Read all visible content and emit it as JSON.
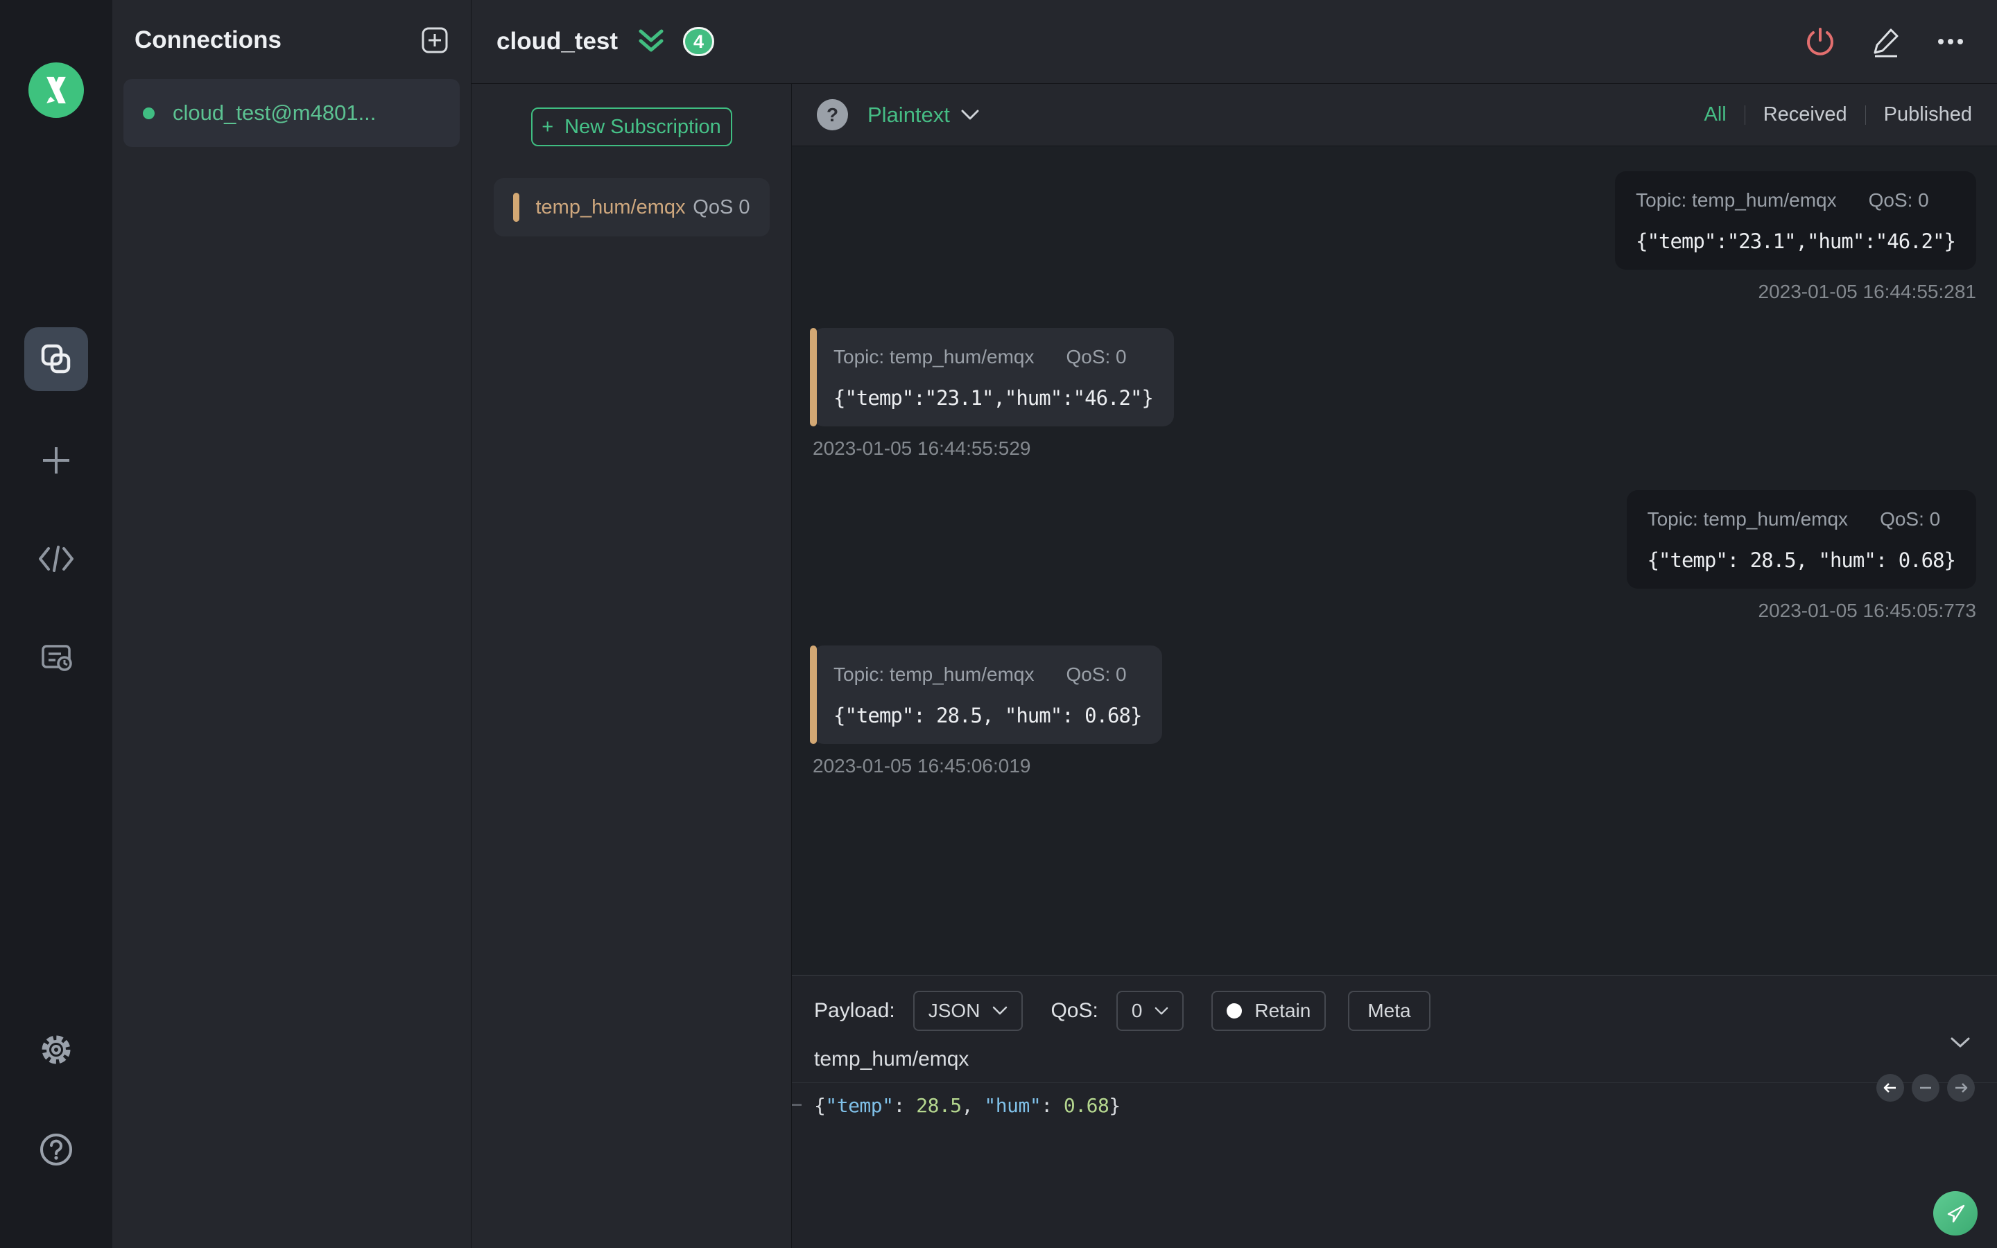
{
  "colors": {
    "accent": "#3fbd81",
    "subscription_accent": "#d3a874",
    "disconnect_red": "#e36f6f"
  },
  "sidebar": {
    "icons": {
      "logo": "mqttx-logo",
      "connections": "overlapping-squares",
      "new_connection": "plus",
      "script": "code-brackets",
      "log": "document-clock",
      "settings": "gear",
      "help": "question-circle"
    }
  },
  "connections": {
    "title": "Connections",
    "items": [
      {
        "name": "cloud_test@m4801...",
        "connected": true
      }
    ]
  },
  "header": {
    "title": "cloud_test",
    "badge_count": "4"
  },
  "subscriptions": {
    "new_button_label": "New Subscription",
    "plus_sign": "+",
    "items": [
      {
        "topic": "temp_hum/emqx",
        "qos": "QoS 0"
      }
    ]
  },
  "messages": {
    "help_glyph": "?",
    "format": "Plaintext",
    "filters": {
      "all": "All",
      "received": "Received",
      "published": "Published",
      "active": "All"
    },
    "items": [
      {
        "direction": "published",
        "topic": "Topic: temp_hum/emqx",
        "qos": "QoS: 0",
        "payload": "{\"temp\":\"23.1\",\"hum\":\"46.2\"}",
        "timestamp": "2023-01-05 16:44:55:281"
      },
      {
        "direction": "received",
        "topic": "Topic: temp_hum/emqx",
        "qos": "QoS: 0",
        "payload": "{\"temp\":\"23.1\",\"hum\":\"46.2\"}",
        "timestamp": "2023-01-05 16:44:55:529"
      },
      {
        "direction": "published",
        "topic": "Topic: temp_hum/emqx",
        "qos": "QoS: 0",
        "payload": "{\"temp\": 28.5, \"hum\": 0.68}",
        "timestamp": "2023-01-05 16:45:05:773"
      },
      {
        "direction": "received",
        "topic": "Topic: temp_hum/emqx",
        "qos": "QoS: 0",
        "payload": "{\"temp\": 28.5, \"hum\": 0.68}",
        "timestamp": "2023-01-05 16:45:06:019"
      }
    ]
  },
  "publish": {
    "payload_label": "Payload:",
    "format_value": "JSON",
    "qos_label": "QoS:",
    "qos_value": "0",
    "retain_label": "Retain",
    "meta_label": "Meta",
    "topic_value": "temp_hum/emqx",
    "editor_tokens": [
      {
        "t": "{"
      },
      {
        "t": "\"temp\"",
        "type": "key"
      },
      {
        "t": ": "
      },
      {
        "t": "28.5",
        "type": "num"
      },
      {
        "t": ", "
      },
      {
        "t": "\"hum\"",
        "type": "key"
      },
      {
        "t": ": "
      },
      {
        "t": "0.68",
        "type": "num"
      },
      {
        "t": "}"
      }
    ]
  }
}
